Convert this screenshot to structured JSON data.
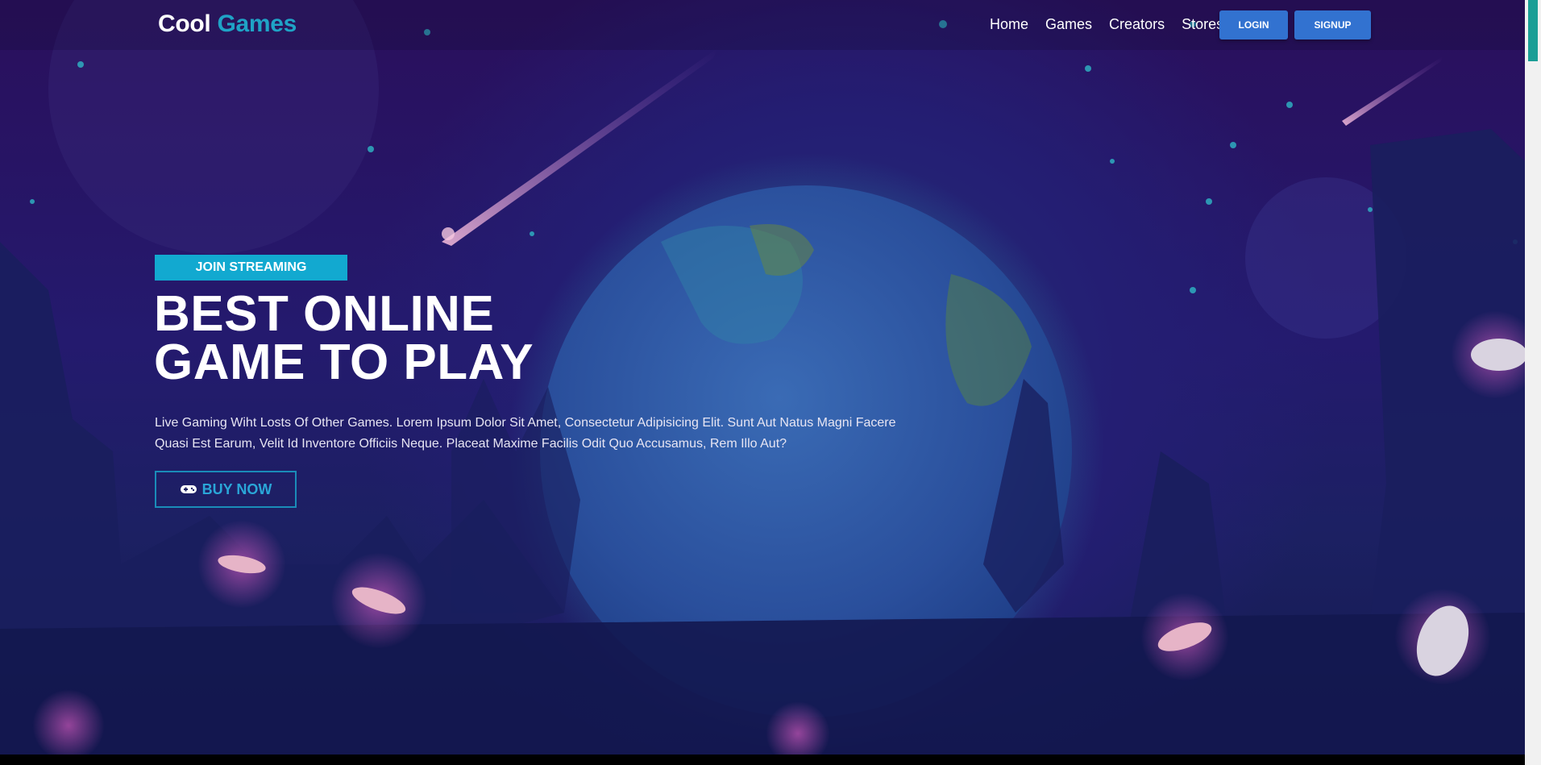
{
  "brand": {
    "first": "Cool",
    "second": "Games"
  },
  "nav": {
    "links": [
      "Home",
      "Games",
      "Creators",
      "Stores"
    ],
    "login": "LOGIN",
    "signup": "SIGNUP"
  },
  "hero": {
    "badge": "JOIN STREAMING",
    "headline_line1": "BEST ONLINE",
    "headline_line2": "GAME TO PLAY",
    "description": "Live Gaming Wiht Losts Of Other Games. Lorem Ipsum Dolor Sit Amet, Consectetur Adipisicing Elit. Sunt Aut Natus Magni Facere Quasi Est Earum, Velit Id Inventore Officiis Neque. Placeat Maxime Facilis Odit Quo Accusamus, Rem Illo Aut?",
    "cta": "BUY NOW",
    "cta_icon": "gamepad-icon"
  },
  "colors": {
    "brand_accent": "#1fa3c6",
    "badge_bg": "#12a9d0",
    "nav_button": "#3272d0",
    "cta_border": "#1a8cb8",
    "scroll_thumb": "#1a9e96"
  }
}
